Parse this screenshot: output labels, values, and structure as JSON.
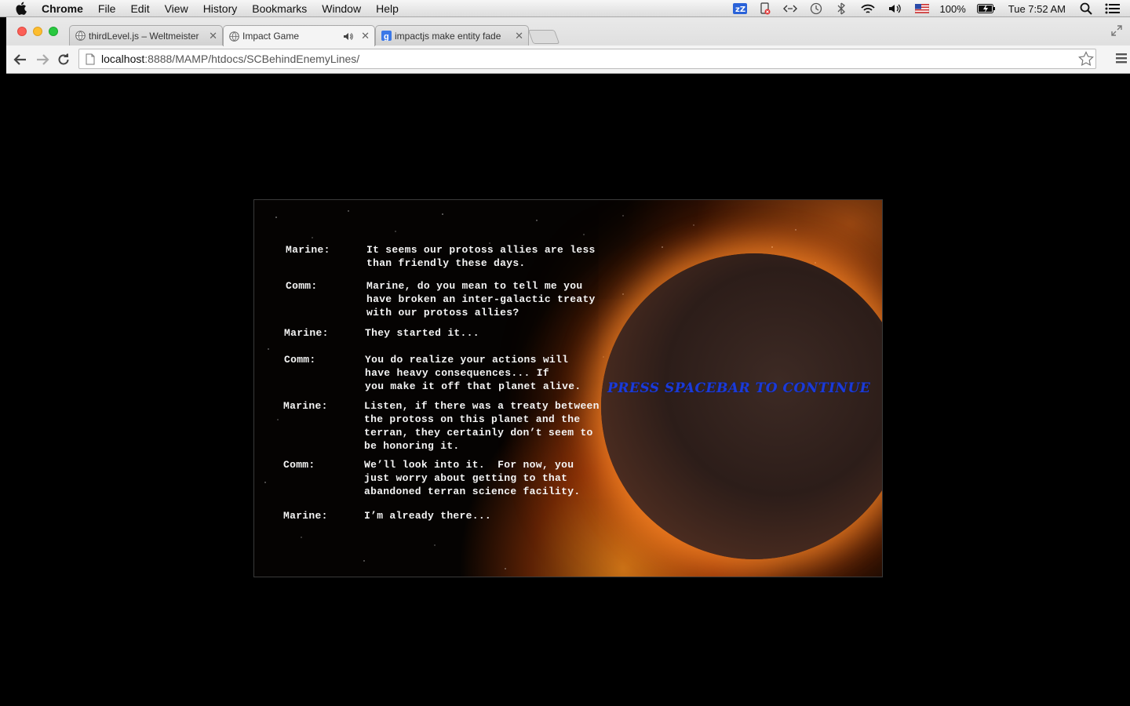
{
  "menubar": {
    "app_name": "Chrome",
    "items": [
      "File",
      "Edit",
      "View",
      "History",
      "Bookmarks",
      "Window",
      "Help"
    ],
    "battery": "100%",
    "clock": "Tue 7:52 AM"
  },
  "browser": {
    "tabs": [
      {
        "title": "thirdLevel.js – Weltmeister",
        "active": false
      },
      {
        "title": "Impact Game",
        "active": true
      },
      {
        "title": "impactjs make entity fade",
        "active": false
      }
    ],
    "url_host": "localhost",
    "url_path": ":8888/MAMP/htdocs/SCBehindEnemyLines/"
  },
  "game": {
    "dialogue": [
      {
        "speaker": "Marine:",
        "text": "It seems our protoss allies are less\nthan friendly these days."
      },
      {
        "speaker": "Comm:",
        "text": "Marine, do you mean to tell me you\nhave broken an inter-galactic treaty\nwith our protoss allies?"
      },
      {
        "speaker": "Marine:",
        "text": "They started it..."
      },
      {
        "speaker": "Comm:",
        "text": "You do realize your actions will\nhave heavy consequences... If\nyou make it off that planet alive."
      },
      {
        "speaker": "Marine:",
        "text": "Listen, if there was a treaty between\nthe protoss on this planet and the\nterran, they certainly don’t seem to\nbe honoring it."
      },
      {
        "speaker": "Comm:",
        "text": "We’ll look into it.  For now, you\njust worry about getting to that\nabandoned terran science facility."
      },
      {
        "speaker": "Marine:",
        "text": "I’m already there..."
      }
    ],
    "prompt": "PRESS SPACEBAR TO CONTINUE",
    "prompt_color": "#1b3bd8"
  }
}
